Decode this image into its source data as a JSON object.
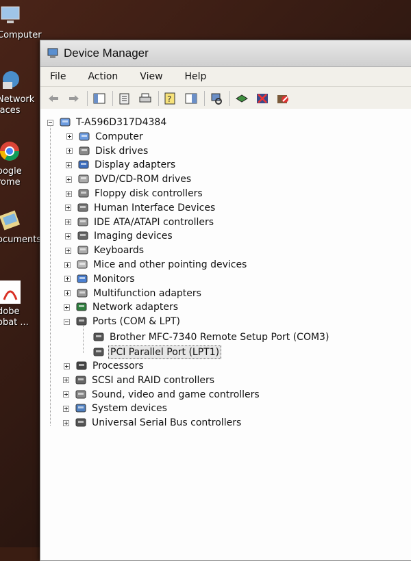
{
  "desktop": {
    "icons": [
      {
        "name": "desktop-icon-computer",
        "label": "Computer"
      },
      {
        "name": "desktop-icon-network",
        "label": "Network\nlaces"
      },
      {
        "name": "desktop-icon-chrome",
        "label": "oogle\nrome"
      },
      {
        "name": "desktop-icon-documents",
        "label": "ocuments"
      },
      {
        "name": "desktop-icon-adobe",
        "label": "dobe\nobat ..."
      }
    ]
  },
  "window": {
    "title": "Device Manager",
    "menu": [
      "File",
      "Action",
      "View",
      "Help"
    ]
  },
  "tree": {
    "root": "T-A596D317D4384",
    "categories": [
      "Computer",
      "Disk drives",
      "Display adapters",
      "DVD/CD-ROM drives",
      "Floppy disk controllers",
      "Human Interface Devices",
      "IDE ATA/ATAPI controllers",
      "Imaging devices",
      "Keyboards",
      "Mice and other pointing devices",
      "Monitors",
      "Multifunction adapters",
      "Network adapters",
      "Ports (COM & LPT)",
      "Processors",
      "SCSI and RAID controllers",
      "Sound, video and game controllers",
      "System devices",
      "Universal Serial Bus controllers"
    ],
    "ports_children": [
      "Brother MFC-7340 Remote Setup Port (COM3)",
      "PCI Parallel Port (LPT1)"
    ]
  }
}
